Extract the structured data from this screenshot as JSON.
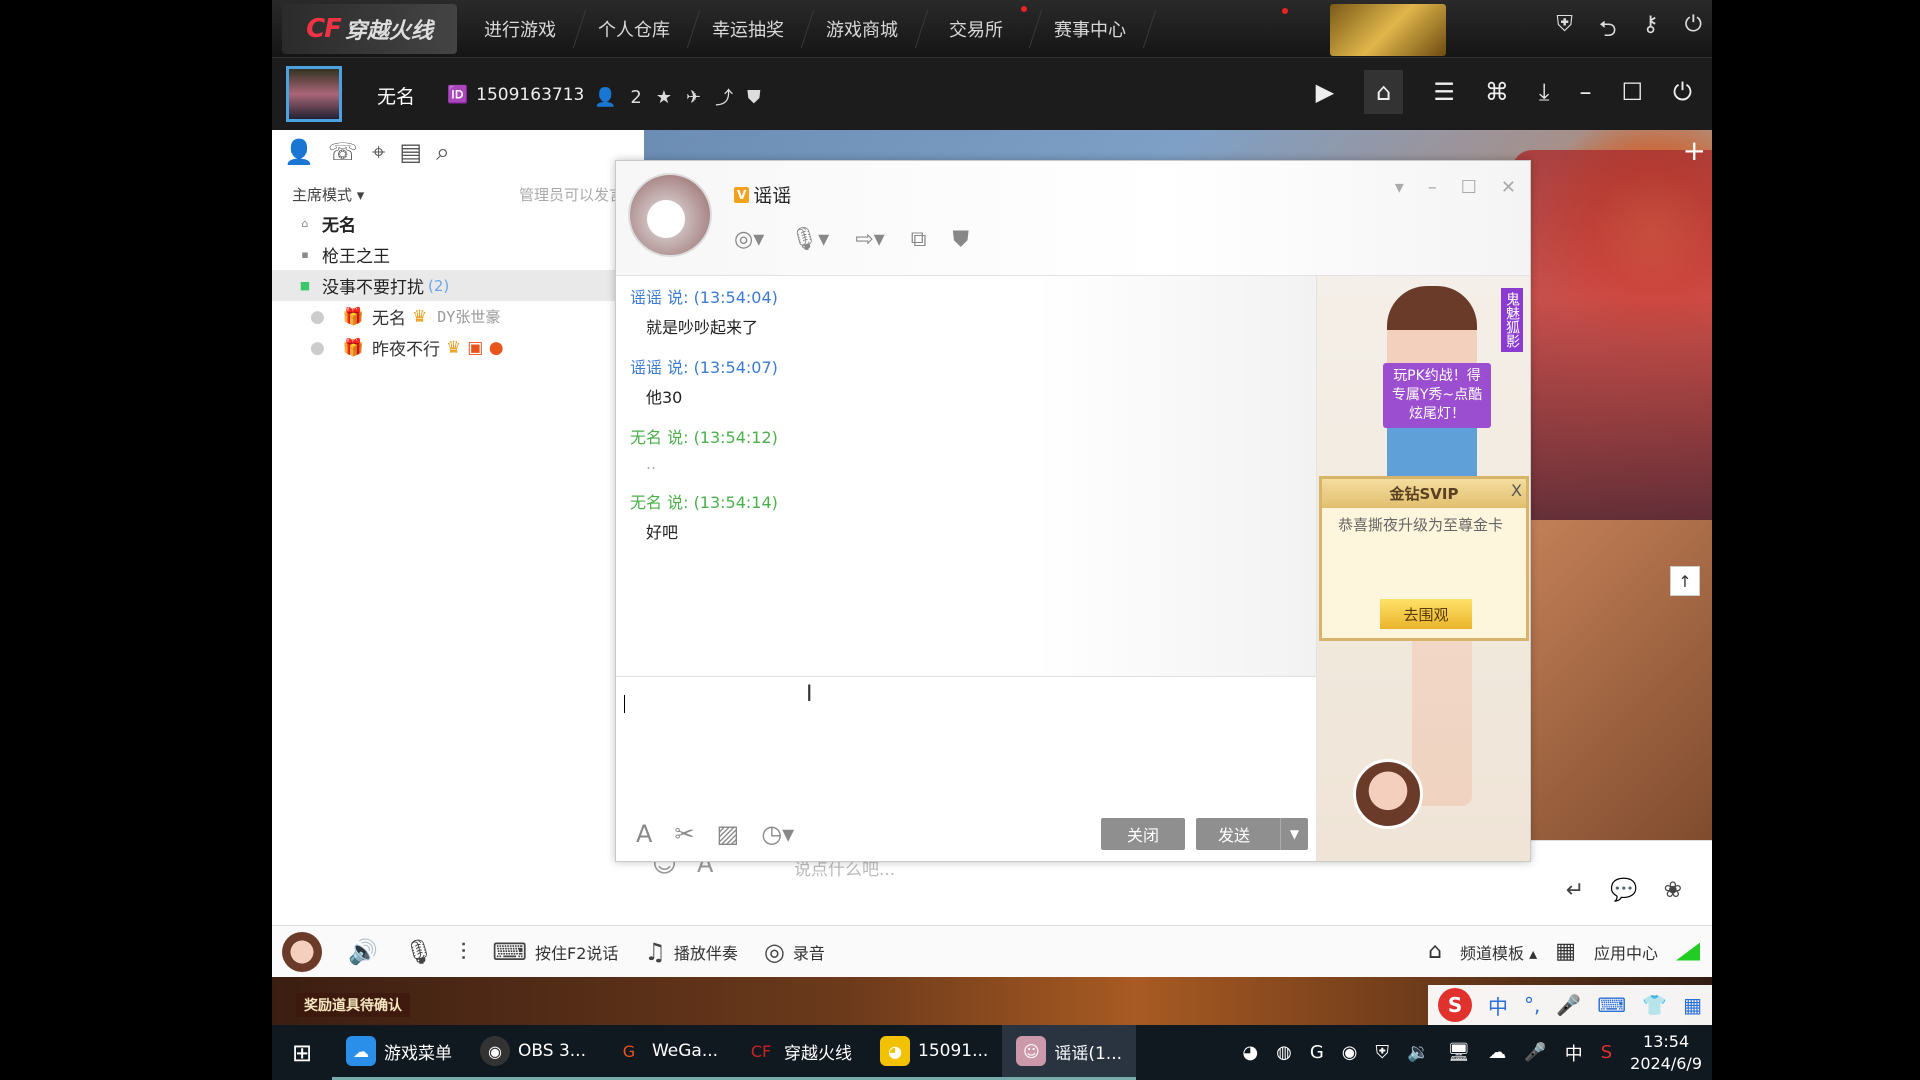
{
  "top_nav": {
    "logo_text": "CF",
    "logo_cn": "穿越火线",
    "tabs": [
      "进行游戏",
      "个人仓库",
      "幸运抽奖",
      "游戏商城",
      "交易所",
      "赛事中心"
    ]
  },
  "user": {
    "name": "无名",
    "id": "1509163713",
    "friends_count": "2"
  },
  "left_panel": {
    "mode_label": "主席模式",
    "mode_hint": "管理员可以发言",
    "channels": [
      {
        "name": "无名",
        "bold": true
      },
      {
        "name": "枪王之王"
      },
      {
        "name": "没事不要打扰",
        "count": "(2)"
      }
    ],
    "members": [
      {
        "name": "无名",
        "tag": "DY张世豪"
      },
      {
        "name": "昨夜不行"
      }
    ]
  },
  "chat": {
    "contact_name": "谣谣",
    "messages": [
      {
        "header": "谣谣 说: (13:54:04)",
        "body": "就是吵吵起来了",
        "color": "blue"
      },
      {
        "header": "谣谣 说: (13:54:07)",
        "body": "他30",
        "color": "blue"
      },
      {
        "header": "无名 说: (13:54:12)",
        "body": "..",
        "color": "green"
      },
      {
        "header": "无名 说: (13:54:14)",
        "body": "好吧",
        "color": "green"
      }
    ],
    "close_label": "关闭",
    "send_label": "发送"
  },
  "side_ad": {
    "bubble": "玩PK约战！得专属Y秀~点酷炫尾灯！",
    "vertical": "鬼魅狐影",
    "svip_title": "金钻SVIP",
    "svip_text": "恭喜撕夜升级为至尊金卡",
    "svip_button": "去围观"
  },
  "channel_input": {
    "placeholder": "说点什么吧..."
  },
  "bottom_bar": {
    "push_to_talk": "按住F2说话",
    "play_music": "播放伴奏",
    "record": "录音",
    "template": "频道模板",
    "app_center": "应用中心"
  },
  "reward_banner": "奖励道具待确认",
  "ime": {
    "lang": "中"
  },
  "taskbar": {
    "apps": [
      {
        "label": "游戏菜单",
        "color": "#2a8fe8"
      },
      {
        "label": "OBS 3...",
        "color": "#333"
      },
      {
        "label": "WeGa...",
        "color": "#e8551d"
      },
      {
        "label": "穿越火线",
        "color": "#c22"
      },
      {
        "label": "15091...",
        "color": "#f2c200"
      },
      {
        "label": "谣谣(1...",
        "color": "#c9a"
      }
    ],
    "tray_lang": "中",
    "time": "13:54",
    "date": "2024/6/9"
  }
}
